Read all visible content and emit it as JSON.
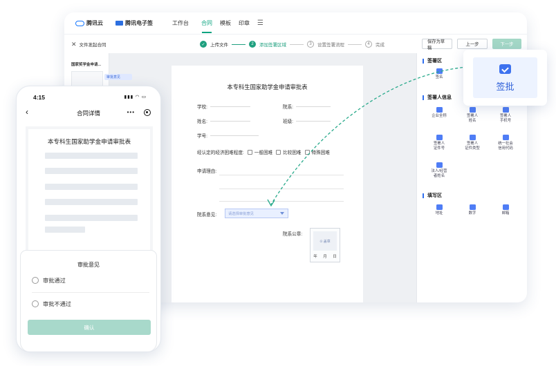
{
  "topnav": {
    "brand1": "腾讯云",
    "brand2": "腾讯电子签",
    "items": [
      "工作台",
      "合同",
      "模板",
      "印章"
    ],
    "menu_icon": "☰"
  },
  "subbar": {
    "back_label": "文件发起合同",
    "steps": [
      {
        "num": "✓",
        "label": "上传文件"
      },
      {
        "num": "2",
        "label": "添加签署区域"
      },
      {
        "num": "3",
        "label": "设置签署流程"
      },
      {
        "num": "4",
        "label": "完成"
      }
    ],
    "save_draft": "保存为草稿",
    "prev": "上一步",
    "next": "下一步"
  },
  "thumbs": {
    "title": "国家奖学金申请...",
    "approve_tag": "审批意见"
  },
  "doc": {
    "title": "本专科生国家助学金申请审批表",
    "school": "学校:",
    "dept": "院系:",
    "name": "姓名:",
    "grade": "班级:",
    "student_no": "学号:",
    "difficulty": "经认定的经济困难程度:",
    "opt1": "一般困难",
    "opt2": "比较困难",
    "opt3": "特殊困难",
    "reason": "申请理由:",
    "dept_opinion": "院系意见:",
    "select_placeholder": "请选择审批意见",
    "dept_seal": "院系公章:",
    "seal_text": "⊙ 盖章",
    "year": "年",
    "month": "月",
    "day": "日"
  },
  "panel": {
    "sign_area": "签署区",
    "sign_item": "签名",
    "signer_info": "签署人信息",
    "signer_items": [
      "企业全称",
      "签署人\n姓名",
      "签署人\n手机号",
      "签署人\n证件号",
      "签署人\n证件类型",
      "统一社会\n信用代码",
      "法人/经营\n者姓名"
    ],
    "fill_area": "填写区",
    "fill_items": [
      "地址",
      "数字",
      "邮箱"
    ]
  },
  "card": {
    "label": "签批",
    "icon": "approve-icon"
  },
  "phone": {
    "time": "4:15",
    "signal": "▮▮▮ ◠ ▭",
    "nav_title": "合同详情",
    "more": "•••",
    "doc_title": "本专科生国家助学金申请审批表",
    "sheet_title": "审批意见",
    "option_pass": "审批通过",
    "option_reject": "审批不通过",
    "confirm": "确认"
  },
  "colors": {
    "accent": "#1fa07f",
    "brand_blue": "#2f6ff0"
  }
}
